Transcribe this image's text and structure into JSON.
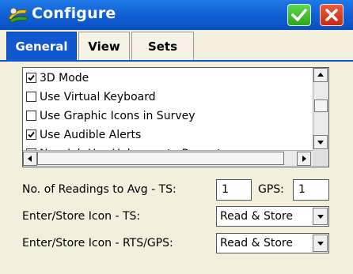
{
  "window": {
    "title": "Configure"
  },
  "colors": {
    "titlebar": "#1158d0",
    "ok_button": "#2fa51f",
    "close_button": "#c72a0f",
    "active_tab": "#1158d0",
    "panel_bg": "#f3efdd"
  },
  "titlebar_buttons": {
    "ok_icon": "checkmark-icon",
    "close_icon": "close-icon"
  },
  "tabs": [
    {
      "label": "General",
      "active": true
    },
    {
      "label": "View",
      "active": false
    },
    {
      "label": "Sets",
      "active": false
    }
  ],
  "options": [
    {
      "label": "3D Mode",
      "checked": true
    },
    {
      "label": "Use Virtual Keyboard",
      "checked": false
    },
    {
      "label": "Use Graphic Icons in Survey",
      "checked": false
    },
    {
      "label": "Use Audible Alerts",
      "checked": true
    },
    {
      "label": "New Job Use Unknown to Prompt",
      "checked": false
    }
  ],
  "readings": {
    "label": "No. of Readings to Avg  -  TS:",
    "ts_value": "1",
    "gps_label": "GPS:",
    "gps_value": "1"
  },
  "enter_store_ts": {
    "label": "Enter/Store Icon - TS:",
    "value": "Read & Store"
  },
  "enter_store_rts": {
    "label": "Enter/Store Icon - RTS/GPS:",
    "value": "Read & Store"
  }
}
